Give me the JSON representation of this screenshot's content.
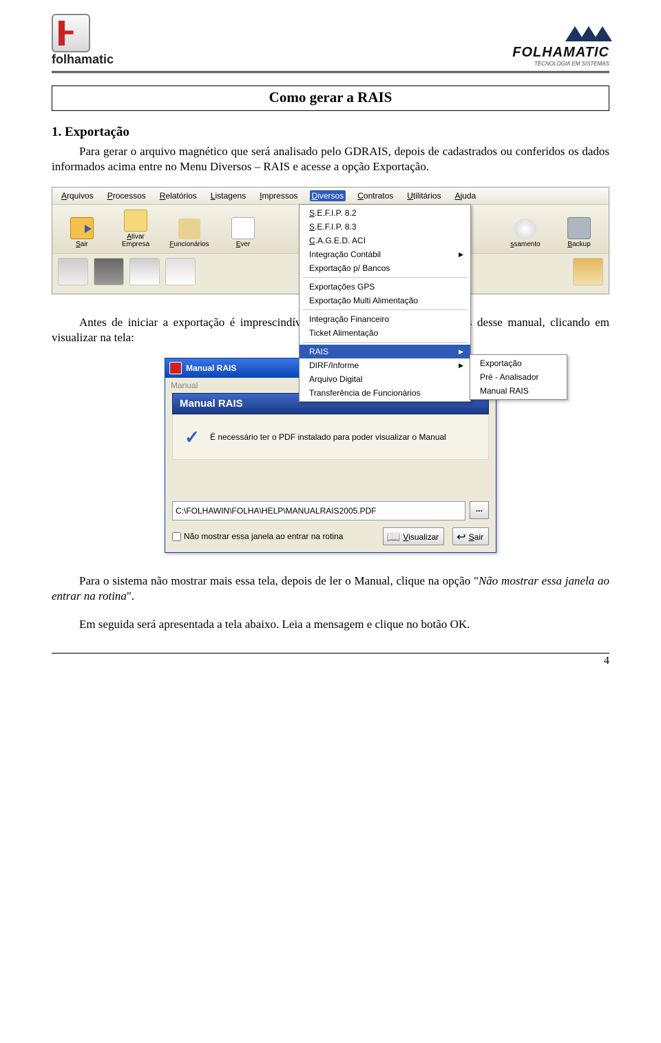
{
  "header": {
    "left_logo_text": "folhamatic",
    "right_logo_text": "FOLHAMATIC",
    "right_logo_sub": "TECNOLOGIA EM SISTEMAS"
  },
  "doc": {
    "title": "Como gerar a RAIS",
    "section1_heading": "1. Exportação",
    "para1": "Para gerar o arquivo magnético que será analisado pelo GDRAIS, depois de cadastrados ou conferidos os dados informados acima entre no Menu Diversos – RAIS e acesse a opção Exportação.",
    "para2": "Antes de iniciar a exportação é imprescindível que o usuário leia as instruções desse manual, clicando em visualizar na tela:",
    "para3_a": "Para o sistema não mostrar mais essa tela, depois de ler o Manual, clique na opção \"",
    "para3_em": "Não mostrar essa janela ao entrar na rotina",
    "para3_b": "\".",
    "para4": "Em seguida será apresentada a tela abaixo. Leia a mensagem e clique no botão OK.",
    "page_number": "4"
  },
  "app1": {
    "menus": [
      "Arquivos",
      "Processos",
      "Relatórios",
      "Listagens",
      "Impressos",
      "Diversos",
      "Contratos",
      "Utilitários",
      "Ajuda"
    ],
    "menu_active_index": 5,
    "toolbar": [
      {
        "label": "Sair",
        "icon": "exit"
      },
      {
        "label": "Ativar Empresa",
        "icon": "folder"
      },
      {
        "label": "Funcionários",
        "icon": "people"
      },
      {
        "label": "Ever",
        "icon": "event"
      },
      {
        "label": "ssamento",
        "icon": "cd"
      },
      {
        "label": "Backup",
        "icon": "tape"
      }
    ],
    "dropdown": [
      {
        "label": "S.E.F.I.P. 8.2",
        "u": 0
      },
      {
        "label": "S.E.F.I.P. 8.3",
        "u": 0
      },
      {
        "label": "C.A.G.E.D. ACI",
        "u": 0
      },
      {
        "label": "Integração Contábil",
        "arrow": true
      },
      {
        "label": "Exportação p/ Bancos"
      },
      {
        "sep": true
      },
      {
        "label": "Exportações GPS"
      },
      {
        "label": "Exportação Multi Alimentação"
      },
      {
        "sep": true
      },
      {
        "label": "Integração Financeiro"
      },
      {
        "label": "Ticket Alimentação"
      },
      {
        "sep": true
      },
      {
        "label": "RAIS",
        "arrow": true,
        "highlight": true
      },
      {
        "label": "DIRF/Informe",
        "arrow": true
      },
      {
        "label": "Arquivo Digital"
      },
      {
        "label": "Transferência de Funcionários"
      }
    ],
    "submenu": [
      "Exportação",
      "Pré - Analisador",
      "Manual RAIS"
    ]
  },
  "dlg": {
    "title": "Manual RAIS",
    "menu_label": "Manual",
    "banner": "Manual  RAIS",
    "info_text": "É necessário ter o PDF instalado para poder visualizar o Manual",
    "path_value": "C:\\FOLHAWIN\\FOLHA\\HELP\\MANUALRAIS2005.PDF",
    "browse_label": "...",
    "checkbox_label": "Não mostrar essa janela ao entrar na rotina",
    "btn_visualizar": "Visualizar",
    "btn_sair": "Sair"
  }
}
